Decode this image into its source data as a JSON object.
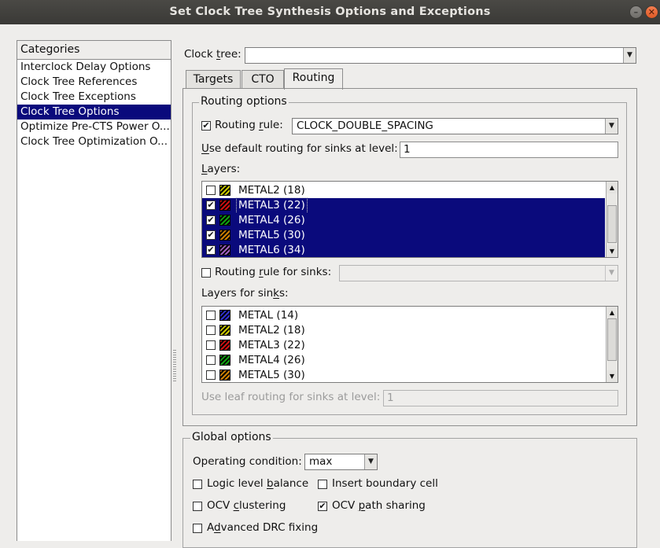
{
  "window": {
    "title": "Set Clock Tree Synthesis Options and Exceptions"
  },
  "sidebar": {
    "header": "Categories",
    "items": [
      {
        "label": "Interclock Delay Options",
        "selected": false
      },
      {
        "label": "Clock Tree References",
        "selected": false
      },
      {
        "label": "Clock Tree Exceptions",
        "selected": false
      },
      {
        "label": "Clock Tree Options",
        "selected": true
      },
      {
        "label": "Optimize Pre-CTS Power O...",
        "selected": false
      },
      {
        "label": "Clock Tree Optimization O...",
        "selected": false
      }
    ]
  },
  "clock_tree": {
    "label_pre": "Clock ",
    "label_ul": "t",
    "label_post": "ree:",
    "value": ""
  },
  "tabs": [
    {
      "label": "Targets",
      "active": false
    },
    {
      "label": "CTO",
      "active": false
    },
    {
      "label": "Routing",
      "active": true
    }
  ],
  "routing": {
    "group_title": "Routing options",
    "routing_rule": {
      "pre": "Routing ",
      "ul": "r",
      "post": "ule:",
      "checked": true,
      "value": "CLOCK_DOUBLE_SPACING"
    },
    "default_routing": {
      "ul": "U",
      "post": "se default routing for sinks at level:",
      "value": "1"
    },
    "layers_label": {
      "ul": "L",
      "post": "ayers:"
    },
    "layers": [
      {
        "name": "METAL2 (18)",
        "checked": false,
        "selected": false,
        "color": "#c8c800"
      },
      {
        "name": "METAL3 (22)",
        "checked": true,
        "selected": true,
        "color": "#d01010"
      },
      {
        "name": "METAL4 (26)",
        "checked": true,
        "selected": true,
        "color": "#10a010"
      },
      {
        "name": "METAL5 (30)",
        "checked": true,
        "selected": true,
        "color": "#d08000"
      },
      {
        "name": "METAL6 (34)",
        "checked": true,
        "selected": true,
        "color": "#a060c0"
      }
    ],
    "sink_rule": {
      "pre": "Routing ",
      "ul": "r",
      "post": "ule for sinks:",
      "checked": false,
      "value": ""
    },
    "sink_layers_label": {
      "pre": "Layers for sin",
      "ul": "k",
      "post": "s:"
    },
    "sink_layers": [
      {
        "name": "METAL (14)",
        "checked": false,
        "color": "#3030d0"
      },
      {
        "name": "METAL2 (18)",
        "checked": false,
        "color": "#c8c800"
      },
      {
        "name": "METAL3 (22)",
        "checked": false,
        "color": "#d01010"
      },
      {
        "name": "METAL4 (26)",
        "checked": false,
        "color": "#10a010"
      },
      {
        "name": "METAL5 (30)",
        "checked": false,
        "color": "#d08000"
      }
    ],
    "leaf_routing": {
      "label": "Use leaf routing for sinks at level:",
      "value": "1"
    }
  },
  "global": {
    "group_title": "Global options",
    "operating_condition": {
      "label": "Operating condition:",
      "value": "max"
    },
    "logic_level_balance": {
      "pre": "Logic level ",
      "ul": "b",
      "post": "alance",
      "checked": false
    },
    "insert_boundary_cell": {
      "label": "Insert boundary cell",
      "checked": false
    },
    "ocv_clustering": {
      "pre": "OCV ",
      "ul": "c",
      "post": "lustering",
      "checked": false
    },
    "ocv_path_sharing": {
      "pre": "OCV ",
      "ul": "p",
      "post": "ath sharing",
      "checked": true
    },
    "advanced_drc": {
      "pre": "A",
      "ul": "d",
      "post": "vanced DRC fixing",
      "checked": false
    }
  }
}
